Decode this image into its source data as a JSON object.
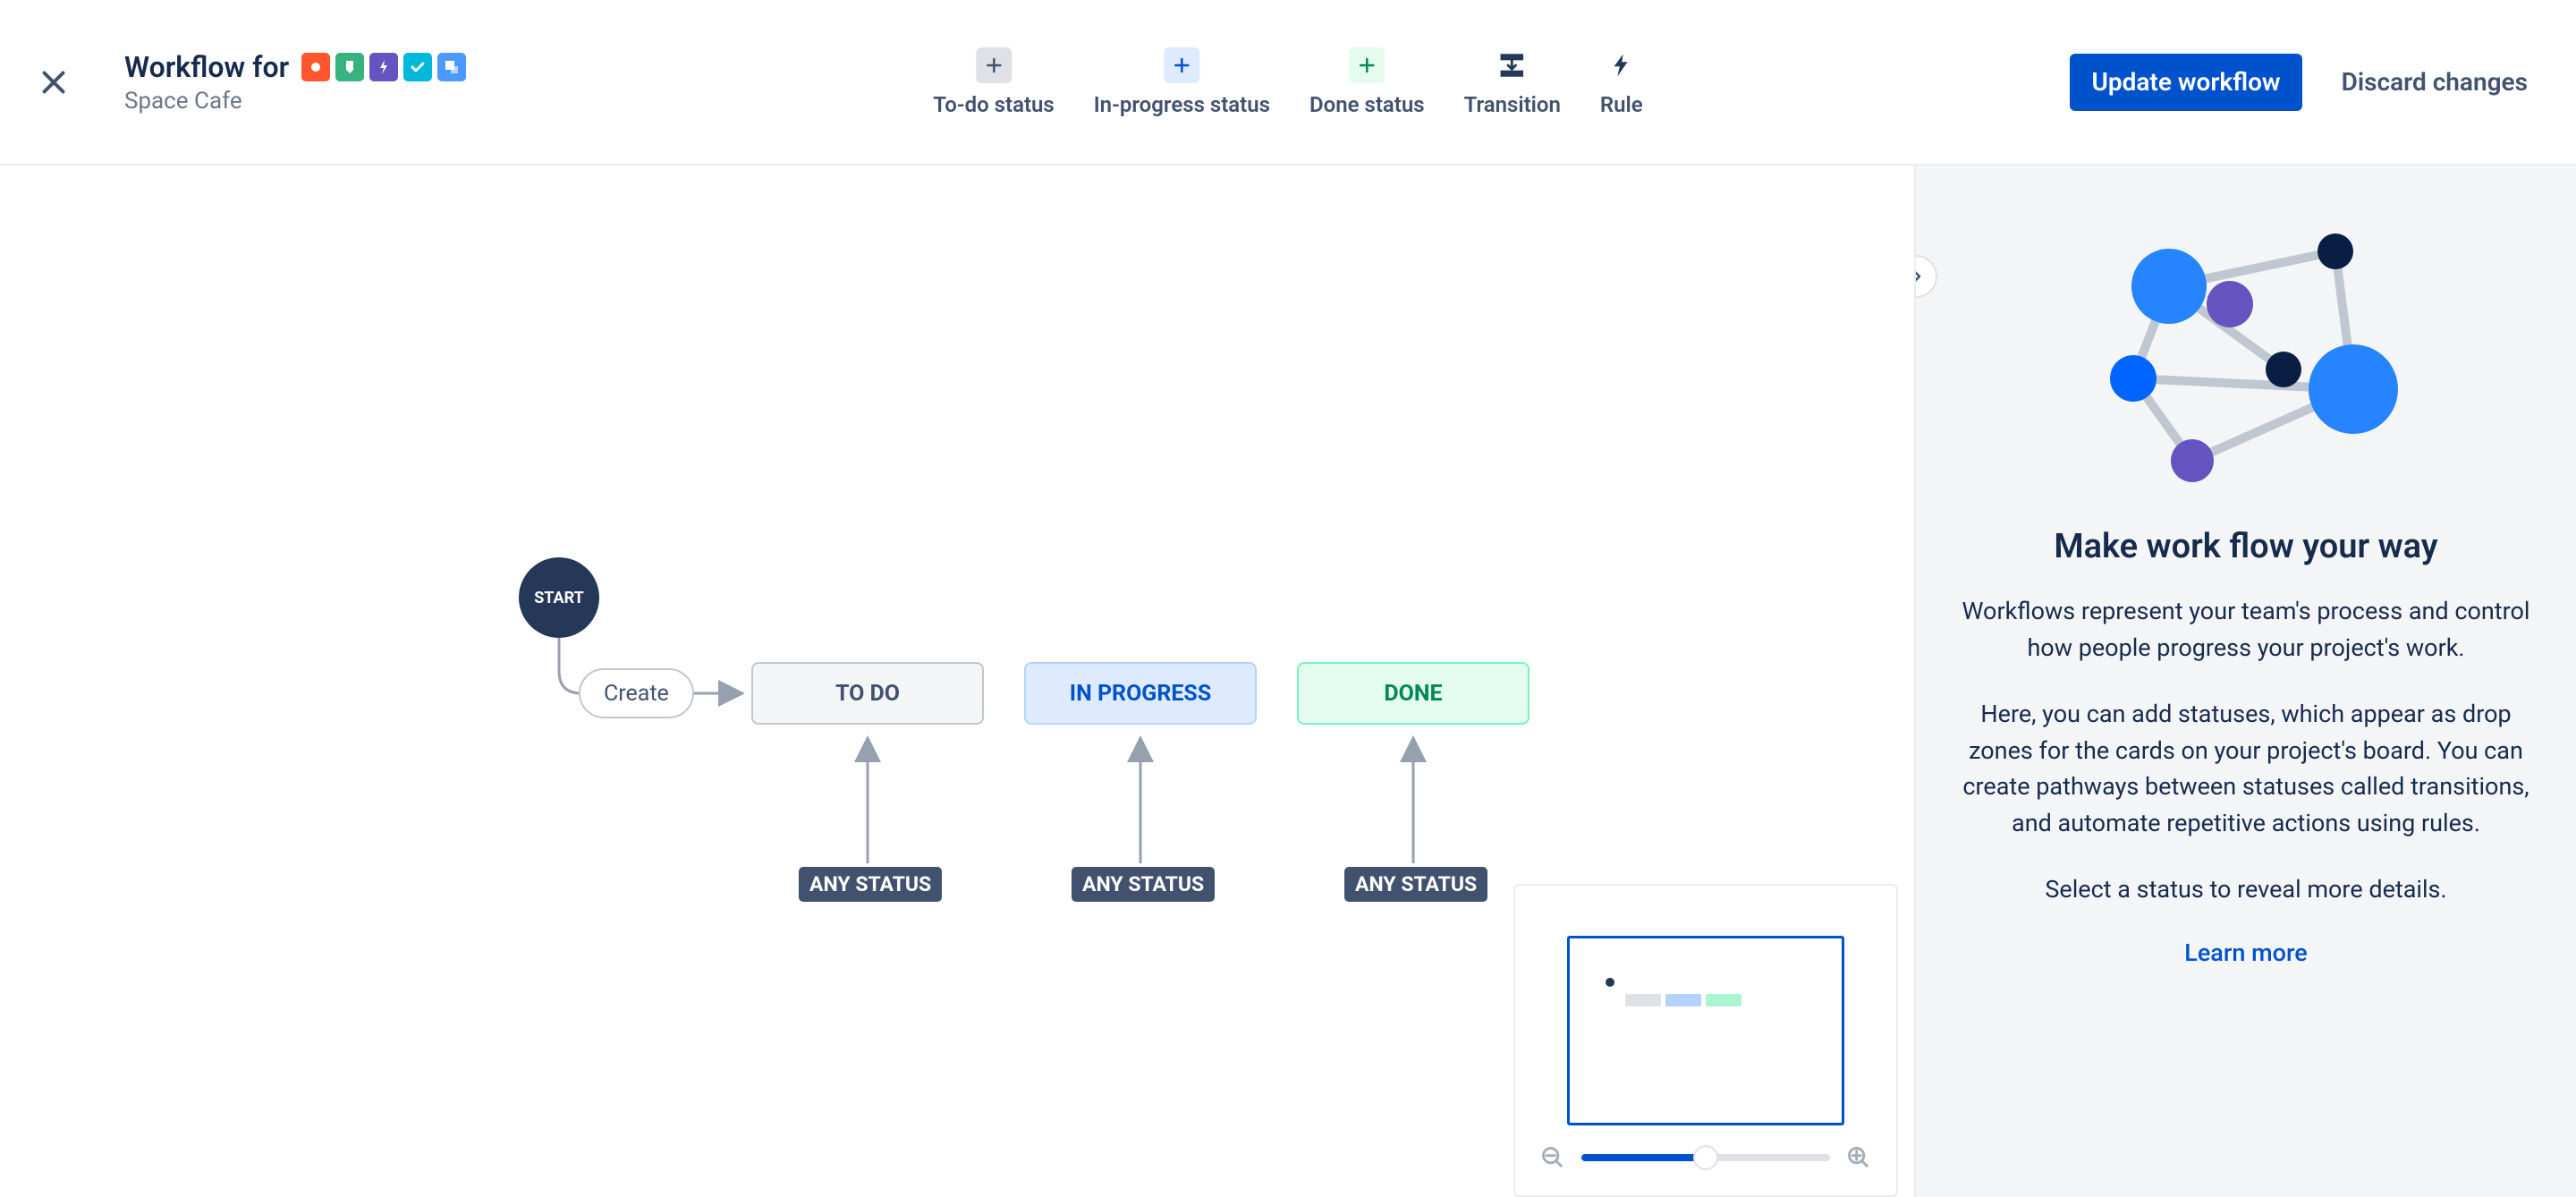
{
  "header": {
    "title": "Workflow for",
    "subtitle": "Space Cafe",
    "issueIcons": [
      {
        "name": "epic-icon",
        "color": "#FF5630"
      },
      {
        "name": "story-icon",
        "color": "#36B37E"
      },
      {
        "name": "bug-icon",
        "color": "#6554C0"
      },
      {
        "name": "task-icon",
        "color": "#00B8D9"
      },
      {
        "name": "subtask-icon",
        "color": "#4C9AFF"
      }
    ],
    "toolbar": {
      "todo": "To-do status",
      "inprogress": "In-progress status",
      "done": "Done status",
      "transition": "Transition",
      "rule": "Rule"
    },
    "update": "Update workflow",
    "discard": "Discard changes"
  },
  "canvas": {
    "start": "START",
    "create": "Create",
    "todo": "TO DO",
    "inprogress": "IN PROGRESS",
    "done": "DONE",
    "anyStatus": "ANY STATUS"
  },
  "panel": {
    "title": "Make work flow your way",
    "p1": "Workflows represent your team's process and control how people progress your project's work.",
    "p2": "Here, you can add statuses, which appear as drop zones for the cards on your project's board. You can create pathways between statuses called transitions, and automate repetitive actions using rules.",
    "p3": "Select a status to reveal more details.",
    "learnMore": "Learn more"
  }
}
